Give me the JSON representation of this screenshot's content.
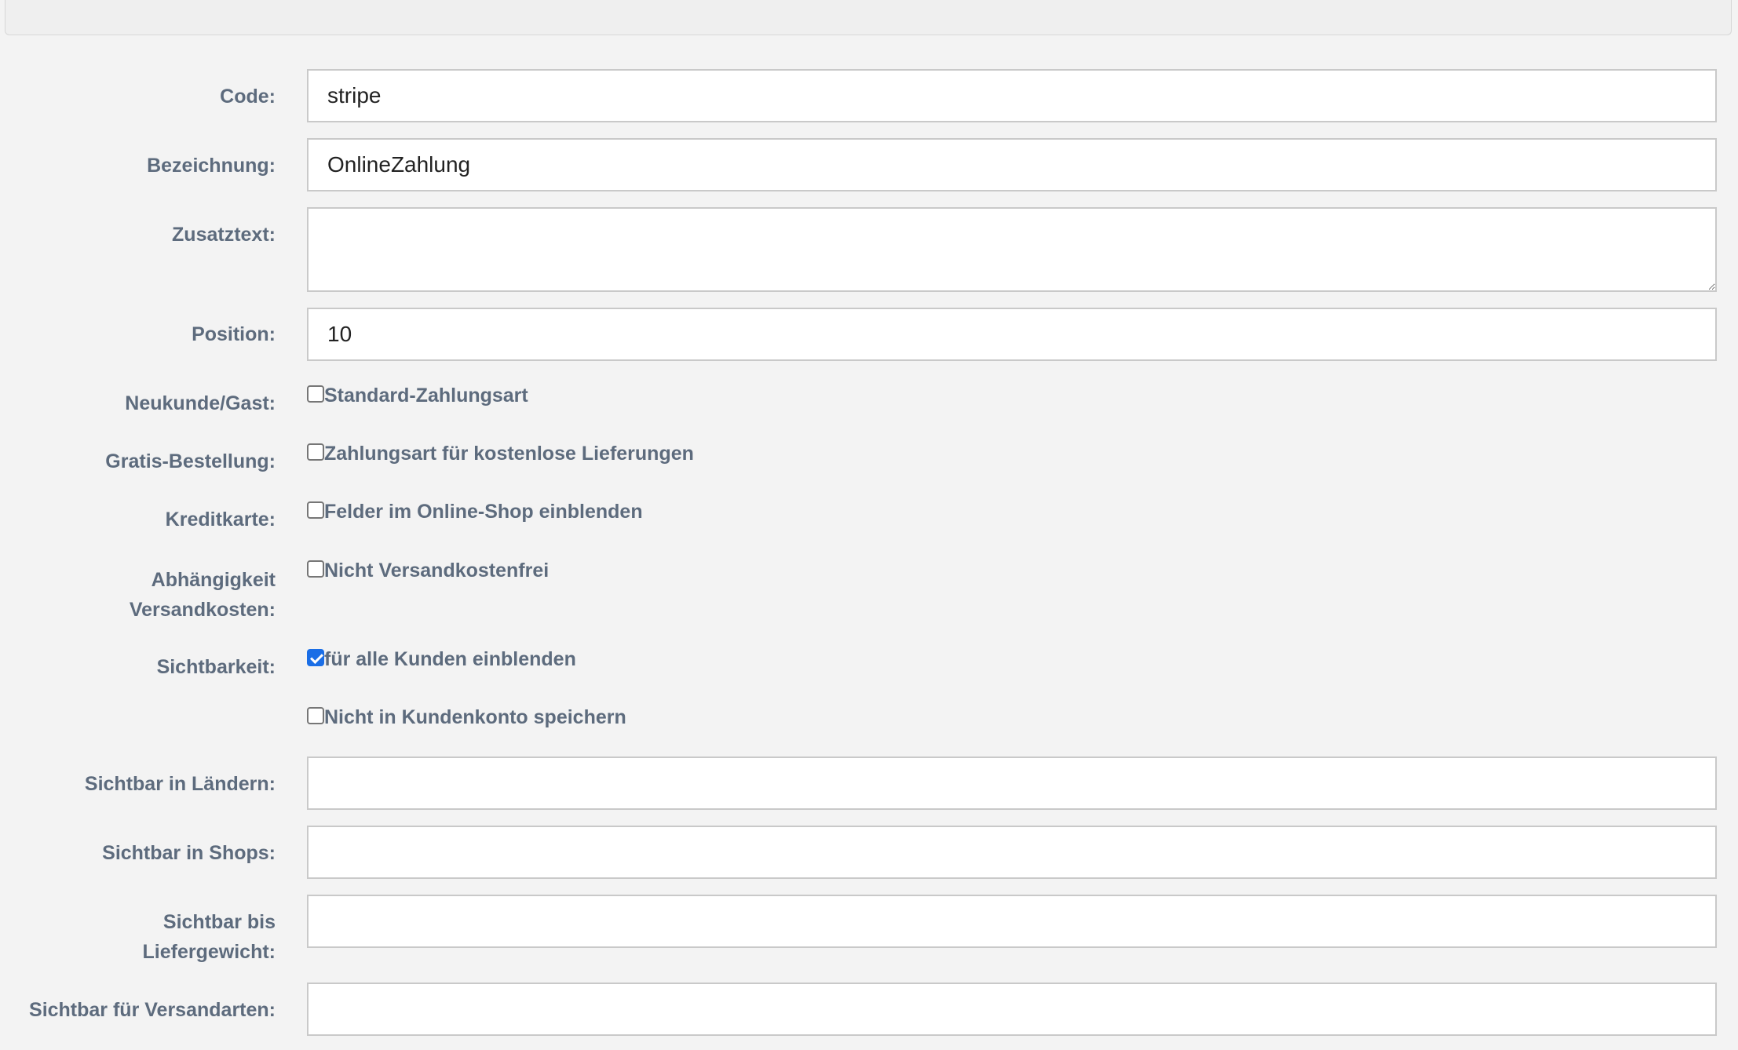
{
  "form": {
    "code": {
      "label": "Code:",
      "value": "stripe"
    },
    "bezeichnung": {
      "label": "Bezeichnung:",
      "value": "OnlineZahlung"
    },
    "zusatztext": {
      "label": "Zusatztext:",
      "value": ""
    },
    "position": {
      "label": "Position:",
      "value": "10"
    },
    "neukunde": {
      "label": "Neukunde/Gast:",
      "option": "Standard-Zahlungsart",
      "checked": false
    },
    "gratis": {
      "label": "Gratis-Bestellung:",
      "option": "Zahlungsart für kostenlose Lieferungen",
      "checked": false
    },
    "kreditkarte": {
      "label": "Kreditkarte:",
      "option": "Felder im Online-Shop einblenden",
      "checked": false
    },
    "abhaengigkeit": {
      "label_line1": "Abhängigkeit",
      "label_line2": "Versandkosten:",
      "option": "Nicht Versandkostenfrei",
      "checked": false
    },
    "sichtbarkeit": {
      "label": "Sichtbarkeit:",
      "option": "für alle Kunden einblenden",
      "checked": true
    },
    "kundenkonto": {
      "option": "Nicht in Kundenkonto speichern",
      "checked": false
    },
    "laender": {
      "label": "Sichtbar in Ländern:",
      "value": ""
    },
    "shops": {
      "label": "Sichtbar in Shops:",
      "value": ""
    },
    "liefergewicht": {
      "label_line1": "Sichtbar bis",
      "label_line2": "Liefergewicht:",
      "value": ""
    },
    "versandarten": {
      "label": "Sichtbar für Versandarten:",
      "value": ""
    }
  },
  "colors": {
    "label": "#5d6b7d",
    "checkbox_checked": "#1a6ee6",
    "background": "#f3f3f3"
  }
}
